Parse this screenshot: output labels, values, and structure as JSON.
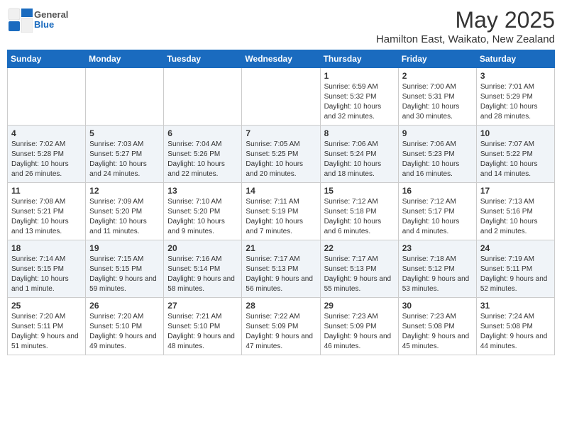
{
  "header": {
    "logo_general": "General",
    "logo_blue": "Blue",
    "month_title": "May 2025",
    "location": "Hamilton East, Waikato, New Zealand"
  },
  "weekdays": [
    "Sunday",
    "Monday",
    "Tuesday",
    "Wednesday",
    "Thursday",
    "Friday",
    "Saturday"
  ],
  "weeks": [
    [
      {
        "day": "",
        "sunrise": "",
        "sunset": "",
        "daylight": ""
      },
      {
        "day": "",
        "sunrise": "",
        "sunset": "",
        "daylight": ""
      },
      {
        "day": "",
        "sunrise": "",
        "sunset": "",
        "daylight": ""
      },
      {
        "day": "",
        "sunrise": "",
        "sunset": "",
        "daylight": ""
      },
      {
        "day": "1",
        "sunrise": "Sunrise: 6:59 AM",
        "sunset": "Sunset: 5:32 PM",
        "daylight": "Daylight: 10 hours and 32 minutes."
      },
      {
        "day": "2",
        "sunrise": "Sunrise: 7:00 AM",
        "sunset": "Sunset: 5:31 PM",
        "daylight": "Daylight: 10 hours and 30 minutes."
      },
      {
        "day": "3",
        "sunrise": "Sunrise: 7:01 AM",
        "sunset": "Sunset: 5:29 PM",
        "daylight": "Daylight: 10 hours and 28 minutes."
      }
    ],
    [
      {
        "day": "4",
        "sunrise": "Sunrise: 7:02 AM",
        "sunset": "Sunset: 5:28 PM",
        "daylight": "Daylight: 10 hours and 26 minutes."
      },
      {
        "day": "5",
        "sunrise": "Sunrise: 7:03 AM",
        "sunset": "Sunset: 5:27 PM",
        "daylight": "Daylight: 10 hours and 24 minutes."
      },
      {
        "day": "6",
        "sunrise": "Sunrise: 7:04 AM",
        "sunset": "Sunset: 5:26 PM",
        "daylight": "Daylight: 10 hours and 22 minutes."
      },
      {
        "day": "7",
        "sunrise": "Sunrise: 7:05 AM",
        "sunset": "Sunset: 5:25 PM",
        "daylight": "Daylight: 10 hours and 20 minutes."
      },
      {
        "day": "8",
        "sunrise": "Sunrise: 7:06 AM",
        "sunset": "Sunset: 5:24 PM",
        "daylight": "Daylight: 10 hours and 18 minutes."
      },
      {
        "day": "9",
        "sunrise": "Sunrise: 7:06 AM",
        "sunset": "Sunset: 5:23 PM",
        "daylight": "Daylight: 10 hours and 16 minutes."
      },
      {
        "day": "10",
        "sunrise": "Sunrise: 7:07 AM",
        "sunset": "Sunset: 5:22 PM",
        "daylight": "Daylight: 10 hours and 14 minutes."
      }
    ],
    [
      {
        "day": "11",
        "sunrise": "Sunrise: 7:08 AM",
        "sunset": "Sunset: 5:21 PM",
        "daylight": "Daylight: 10 hours and 13 minutes."
      },
      {
        "day": "12",
        "sunrise": "Sunrise: 7:09 AM",
        "sunset": "Sunset: 5:20 PM",
        "daylight": "Daylight: 10 hours and 11 minutes."
      },
      {
        "day": "13",
        "sunrise": "Sunrise: 7:10 AM",
        "sunset": "Sunset: 5:20 PM",
        "daylight": "Daylight: 10 hours and 9 minutes."
      },
      {
        "day": "14",
        "sunrise": "Sunrise: 7:11 AM",
        "sunset": "Sunset: 5:19 PM",
        "daylight": "Daylight: 10 hours and 7 minutes."
      },
      {
        "day": "15",
        "sunrise": "Sunrise: 7:12 AM",
        "sunset": "Sunset: 5:18 PM",
        "daylight": "Daylight: 10 hours and 6 minutes."
      },
      {
        "day": "16",
        "sunrise": "Sunrise: 7:12 AM",
        "sunset": "Sunset: 5:17 PM",
        "daylight": "Daylight: 10 hours and 4 minutes."
      },
      {
        "day": "17",
        "sunrise": "Sunrise: 7:13 AM",
        "sunset": "Sunset: 5:16 PM",
        "daylight": "Daylight: 10 hours and 2 minutes."
      }
    ],
    [
      {
        "day": "18",
        "sunrise": "Sunrise: 7:14 AM",
        "sunset": "Sunset: 5:15 PM",
        "daylight": "Daylight: 10 hours and 1 minute."
      },
      {
        "day": "19",
        "sunrise": "Sunrise: 7:15 AM",
        "sunset": "Sunset: 5:15 PM",
        "daylight": "Daylight: 9 hours and 59 minutes."
      },
      {
        "day": "20",
        "sunrise": "Sunrise: 7:16 AM",
        "sunset": "Sunset: 5:14 PM",
        "daylight": "Daylight: 9 hours and 58 minutes."
      },
      {
        "day": "21",
        "sunrise": "Sunrise: 7:17 AM",
        "sunset": "Sunset: 5:13 PM",
        "daylight": "Daylight: 9 hours and 56 minutes."
      },
      {
        "day": "22",
        "sunrise": "Sunrise: 7:17 AM",
        "sunset": "Sunset: 5:13 PM",
        "daylight": "Daylight: 9 hours and 55 minutes."
      },
      {
        "day": "23",
        "sunrise": "Sunrise: 7:18 AM",
        "sunset": "Sunset: 5:12 PM",
        "daylight": "Daylight: 9 hours and 53 minutes."
      },
      {
        "day": "24",
        "sunrise": "Sunrise: 7:19 AM",
        "sunset": "Sunset: 5:11 PM",
        "daylight": "Daylight: 9 hours and 52 minutes."
      }
    ],
    [
      {
        "day": "25",
        "sunrise": "Sunrise: 7:20 AM",
        "sunset": "Sunset: 5:11 PM",
        "daylight": "Daylight: 9 hours and 51 minutes."
      },
      {
        "day": "26",
        "sunrise": "Sunrise: 7:20 AM",
        "sunset": "Sunset: 5:10 PM",
        "daylight": "Daylight: 9 hours and 49 minutes."
      },
      {
        "day": "27",
        "sunrise": "Sunrise: 7:21 AM",
        "sunset": "Sunset: 5:10 PM",
        "daylight": "Daylight: 9 hours and 48 minutes."
      },
      {
        "day": "28",
        "sunrise": "Sunrise: 7:22 AM",
        "sunset": "Sunset: 5:09 PM",
        "daylight": "Daylight: 9 hours and 47 minutes."
      },
      {
        "day": "29",
        "sunrise": "Sunrise: 7:23 AM",
        "sunset": "Sunset: 5:09 PM",
        "daylight": "Daylight: 9 hours and 46 minutes."
      },
      {
        "day": "30",
        "sunrise": "Sunrise: 7:23 AM",
        "sunset": "Sunset: 5:08 PM",
        "daylight": "Daylight: 9 hours and 45 minutes."
      },
      {
        "day": "31",
        "sunrise": "Sunrise: 7:24 AM",
        "sunset": "Sunset: 5:08 PM",
        "daylight": "Daylight: 9 hours and 44 minutes."
      }
    ]
  ]
}
